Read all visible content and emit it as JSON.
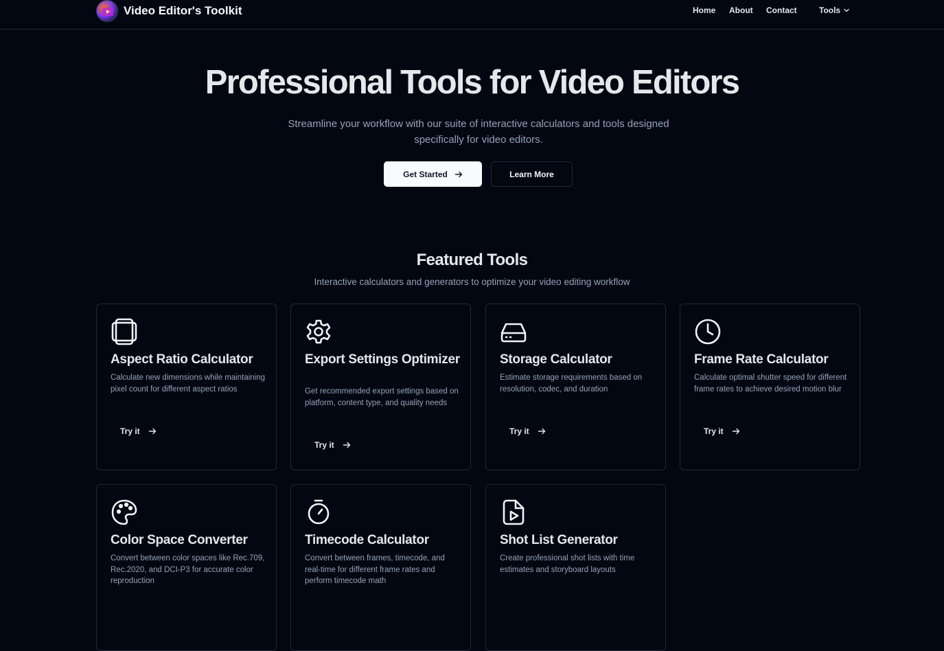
{
  "nav": {
    "brand": "Video Editor's Toolkit",
    "links": [
      {
        "label": "Home"
      },
      {
        "label": "About"
      },
      {
        "label": "Contact"
      },
      {
        "label": "Tools"
      }
    ]
  },
  "hero": {
    "title": "Professional Tools for Video Editors",
    "subtitle": "Streamline your workflow with our suite of interactive calculators and tools designed specifically for video editors.",
    "primary_button": "Get Started",
    "secondary_button": "Learn More"
  },
  "featured": {
    "title": "Featured Tools",
    "subtitle": "Interactive calculators and generators to optimize your video editing workflow",
    "try_label": "Try it",
    "cards": [
      {
        "icon": "aspect-ratio-icon",
        "title": "Aspect Ratio Calculator",
        "description": "Calculate new dimensions while maintaining pixel count for different aspect ratios"
      },
      {
        "icon": "gear-icon",
        "title": "Export Settings Optimizer",
        "description": "Get recommended export settings based on platform, content type, and quality needs"
      },
      {
        "icon": "hard-drive-icon",
        "title": "Storage Calculator",
        "description": "Estimate storage requirements based on resolution, codec, and duration"
      },
      {
        "icon": "clock-icon",
        "title": "Frame Rate Calculator",
        "description": "Calculate optimal shutter speed for different frame rates to achieve desired motion blur"
      },
      {
        "icon": "palette-icon",
        "title": "Color Space Converter",
        "description": "Convert between color spaces like Rec.709, Rec.2020, and DCI-P3 for accurate color reproduction"
      },
      {
        "icon": "stopwatch-icon",
        "title": "Timecode Calculator",
        "description": "Convert between frames, timecode, and real-time for different frame rates and perform timecode math"
      },
      {
        "icon": "file-video-icon",
        "title": "Shot List Generator",
        "description": "Create professional shot lists with time estimates and storyboard layouts"
      }
    ]
  }
}
